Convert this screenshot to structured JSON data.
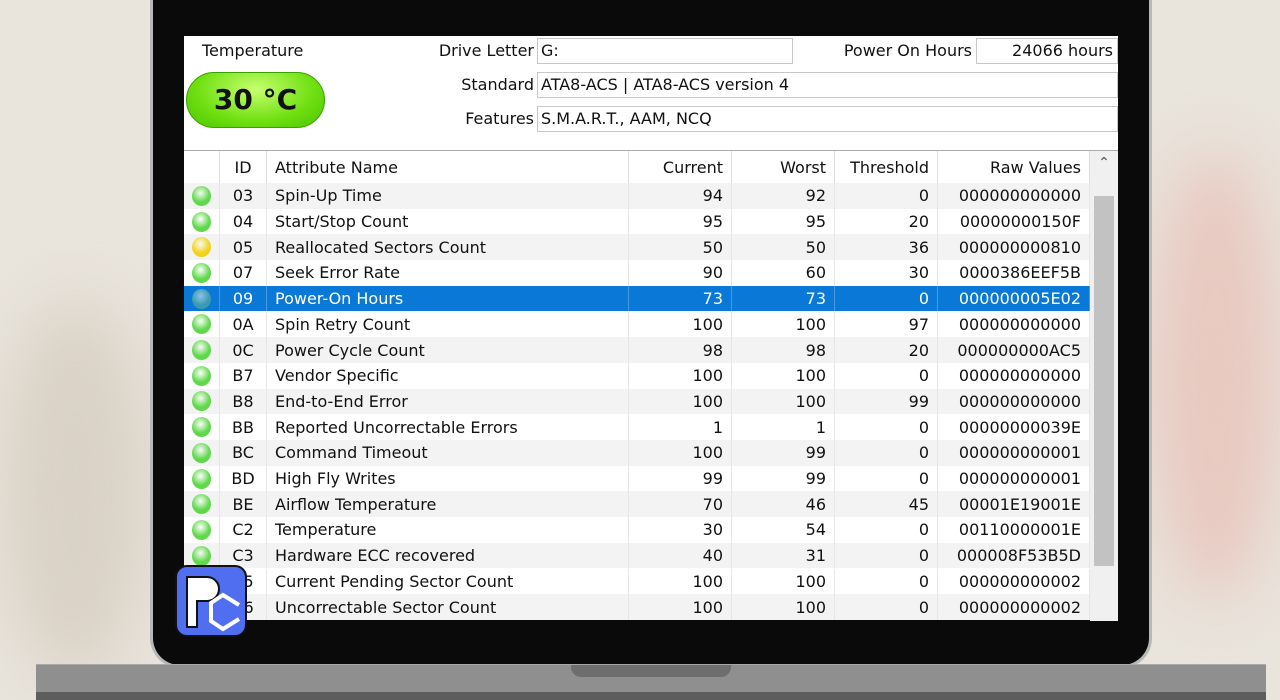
{
  "info": {
    "temperature_label": "Temperature",
    "temperature_value": "30 °C",
    "drive_letter_label": "Drive Letter",
    "drive_letter_value": "G:",
    "power_on_label": "Power On Hours",
    "power_on_value": "24066 hours",
    "standard_label": "Standard",
    "standard_value": "ATA8-ACS | ATA8-ACS version 4",
    "features_label": "Features",
    "features_value": "S.M.A.R.T., AAM, NCQ"
  },
  "columns": [
    "ID",
    "Attribute Name",
    "Current",
    "Worst",
    "Threshold",
    "Raw Values"
  ],
  "colors": {
    "good": "#5fd94a",
    "caution": "#f2d31a",
    "selected": "#3a9ab0"
  },
  "rows": [
    {
      "status": "good",
      "id": "03",
      "name": "Spin-Up Time",
      "current": "94",
      "worst": "92",
      "threshold": "0",
      "raw": "000000000000"
    },
    {
      "status": "good",
      "id": "04",
      "name": "Start/Stop Count",
      "current": "95",
      "worst": "95",
      "threshold": "20",
      "raw": "00000000150F"
    },
    {
      "status": "caution",
      "id": "05",
      "name": "Reallocated Sectors Count",
      "current": "50",
      "worst": "50",
      "threshold": "36",
      "raw": "000000000810"
    },
    {
      "status": "good",
      "id": "07",
      "name": "Seek Error Rate",
      "current": "90",
      "worst": "60",
      "threshold": "30",
      "raw": "0000386EEF5B"
    },
    {
      "status": "selected",
      "id": "09",
      "name": "Power-On Hours",
      "current": "73",
      "worst": "73",
      "threshold": "0",
      "raw": "000000005E02"
    },
    {
      "status": "good",
      "id": "0A",
      "name": "Spin Retry Count",
      "current": "100",
      "worst": "100",
      "threshold": "97",
      "raw": "000000000000"
    },
    {
      "status": "good",
      "id": "0C",
      "name": "Power Cycle Count",
      "current": "98",
      "worst": "98",
      "threshold": "20",
      "raw": "000000000AC5"
    },
    {
      "status": "good",
      "id": "B7",
      "name": "Vendor Specific",
      "current": "100",
      "worst": "100",
      "threshold": "0",
      "raw": "000000000000"
    },
    {
      "status": "good",
      "id": "B8",
      "name": "End-to-End Error",
      "current": "100",
      "worst": "100",
      "threshold": "99",
      "raw": "000000000000"
    },
    {
      "status": "good",
      "id": "BB",
      "name": "Reported Uncorrectable Errors",
      "current": "1",
      "worst": "1",
      "threshold": "0",
      "raw": "00000000039E"
    },
    {
      "status": "good",
      "id": "BC",
      "name": "Command Timeout",
      "current": "100",
      "worst": "99",
      "threshold": "0",
      "raw": "000000000001"
    },
    {
      "status": "good",
      "id": "BD",
      "name": "High Fly Writes",
      "current": "99",
      "worst": "99",
      "threshold": "0",
      "raw": "000000000001"
    },
    {
      "status": "good",
      "id": "BE",
      "name": "Airflow Temperature",
      "current": "70",
      "worst": "46",
      "threshold": "45",
      "raw": "00001E19001E"
    },
    {
      "status": "good",
      "id": "C2",
      "name": "Temperature",
      "current": "30",
      "worst": "54",
      "threshold": "0",
      "raw": "00110000001E"
    },
    {
      "status": "good",
      "id": "C3",
      "name": "Hardware ECC recovered",
      "current": "40",
      "worst": "31",
      "threshold": "0",
      "raw": "000008F53B5D"
    },
    {
      "status": "good",
      "id": "C5",
      "name": "Current Pending Sector Count",
      "current": "100",
      "worst": "100",
      "threshold": "0",
      "raw": "000000000002"
    },
    {
      "status": "good",
      "id": "C6",
      "name": "Uncorrectable Sector Count",
      "current": "100",
      "worst": "100",
      "threshold": "0",
      "raw": "000000000002"
    }
  ]
}
